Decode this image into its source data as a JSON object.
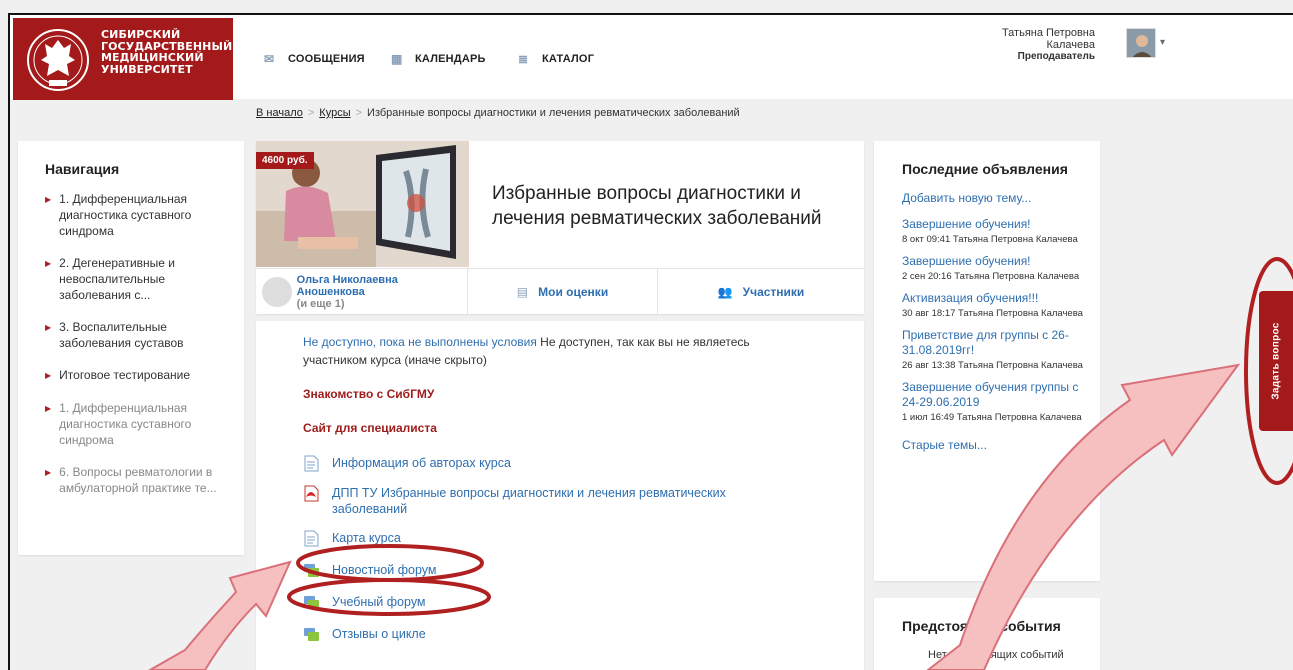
{
  "university": {
    "lines": [
      "СИБИРСКИЙ",
      "ГОСУДАРСТВЕННЫЙ",
      "МЕДИЦИНСКИЙ",
      "УНИВЕРСИТЕТ"
    ],
    "crest_motto": "EX MANIBUS LUX"
  },
  "topnav": {
    "messages": "СООБЩЕНИЯ",
    "calendar": "КАЛЕНДАРЬ",
    "catalog": "КАТАЛОГ"
  },
  "user": {
    "first": "Татьяна Петровна",
    "last": "Калачева",
    "role": "Преподаватель"
  },
  "breadcrumb": {
    "home": "В начало",
    "courses": "Курсы",
    "current": "Избранные вопросы диагностики и лечения ревматических заболеваний"
  },
  "navigation": {
    "title": "Навигация",
    "items": [
      {
        "label": "1. Дифференциальная диагностика суставного синдрома",
        "dim": false
      },
      {
        "label": "2. Дегенеративные и невоспалительные заболевания с...",
        "dim": false
      },
      {
        "label": "3. Воспалительные заболевания суставов",
        "dim": false
      },
      {
        "label": "Итоговое тестирование",
        "dim": false
      },
      {
        "label": "1. Дифференциальная диагностика суставного синдрома",
        "dim": true
      },
      {
        "label": "6. Вопросы ревматологии в амбулаторной практике те...",
        "dim": true
      }
    ]
  },
  "course": {
    "price": "4600 руб.",
    "title": "Избранные вопросы диагностики и лечения ревматических заболеваний",
    "teacher": "Ольга Николаевна Аношенкова",
    "teacher_more": "(и еще 1)",
    "grades": "Мои оценки",
    "participants": "Участники"
  },
  "content": {
    "restrict_link": "Не доступно, пока не выполнены условия",
    "restrict_text": " Не доступен, так как вы не являетесь участником курса (иначе скрыто)",
    "section1": "Знакомство с СибГМУ",
    "section2": "Сайт для специалиста",
    "activities": [
      {
        "label": "Информация об авторах курса",
        "icon": "page-icon"
      },
      {
        "label": "ДПП ТУ Избранные вопросы диагностики и лечения ревматических заболеваний",
        "icon": "pdf-icon"
      },
      {
        "label": "Карта курса",
        "icon": "page-icon"
      },
      {
        "label": "Новостной форум",
        "icon": "forum-icon"
      },
      {
        "label": "Учебный форум",
        "icon": "forum-icon"
      },
      {
        "label": "Отзывы о цикле",
        "icon": "forum-icon"
      }
    ]
  },
  "announcements": {
    "title": "Последние объявления",
    "add": "Добавить новую тему...",
    "items": [
      {
        "title": "Завершение обучения!",
        "meta": "8 окт 09:41  Татьяна Петровна Калачева"
      },
      {
        "title": "Завершение обучения!",
        "meta": "2 сен 20:16  Татьяна Петровна Калачева"
      },
      {
        "title": "Активизация обучения!!!",
        "meta": "30 авг 18:17  Татьяна Петровна Калачева"
      },
      {
        "title": "Приветствие для группы с 26-31.08.2019гг!",
        "meta": "26 авг 13:38  Татьяна Петровна Калачева"
      },
      {
        "title": "Завершение обучения группы с 24-29.06.2019",
        "meta": "1 июл 16:49  Татьяна Петровна Калачева"
      }
    ],
    "old": "Старые темы..."
  },
  "events": {
    "title": "Предстоящие события",
    "empty": "Нет предстоящих событий"
  },
  "ask_tab": "Задать вопрос",
  "colors": {
    "brand": "#a41a1a",
    "link": "#2f6fb0",
    "annotation_outline": "#b02020",
    "annotation_arrow": "#f6c0c0"
  }
}
